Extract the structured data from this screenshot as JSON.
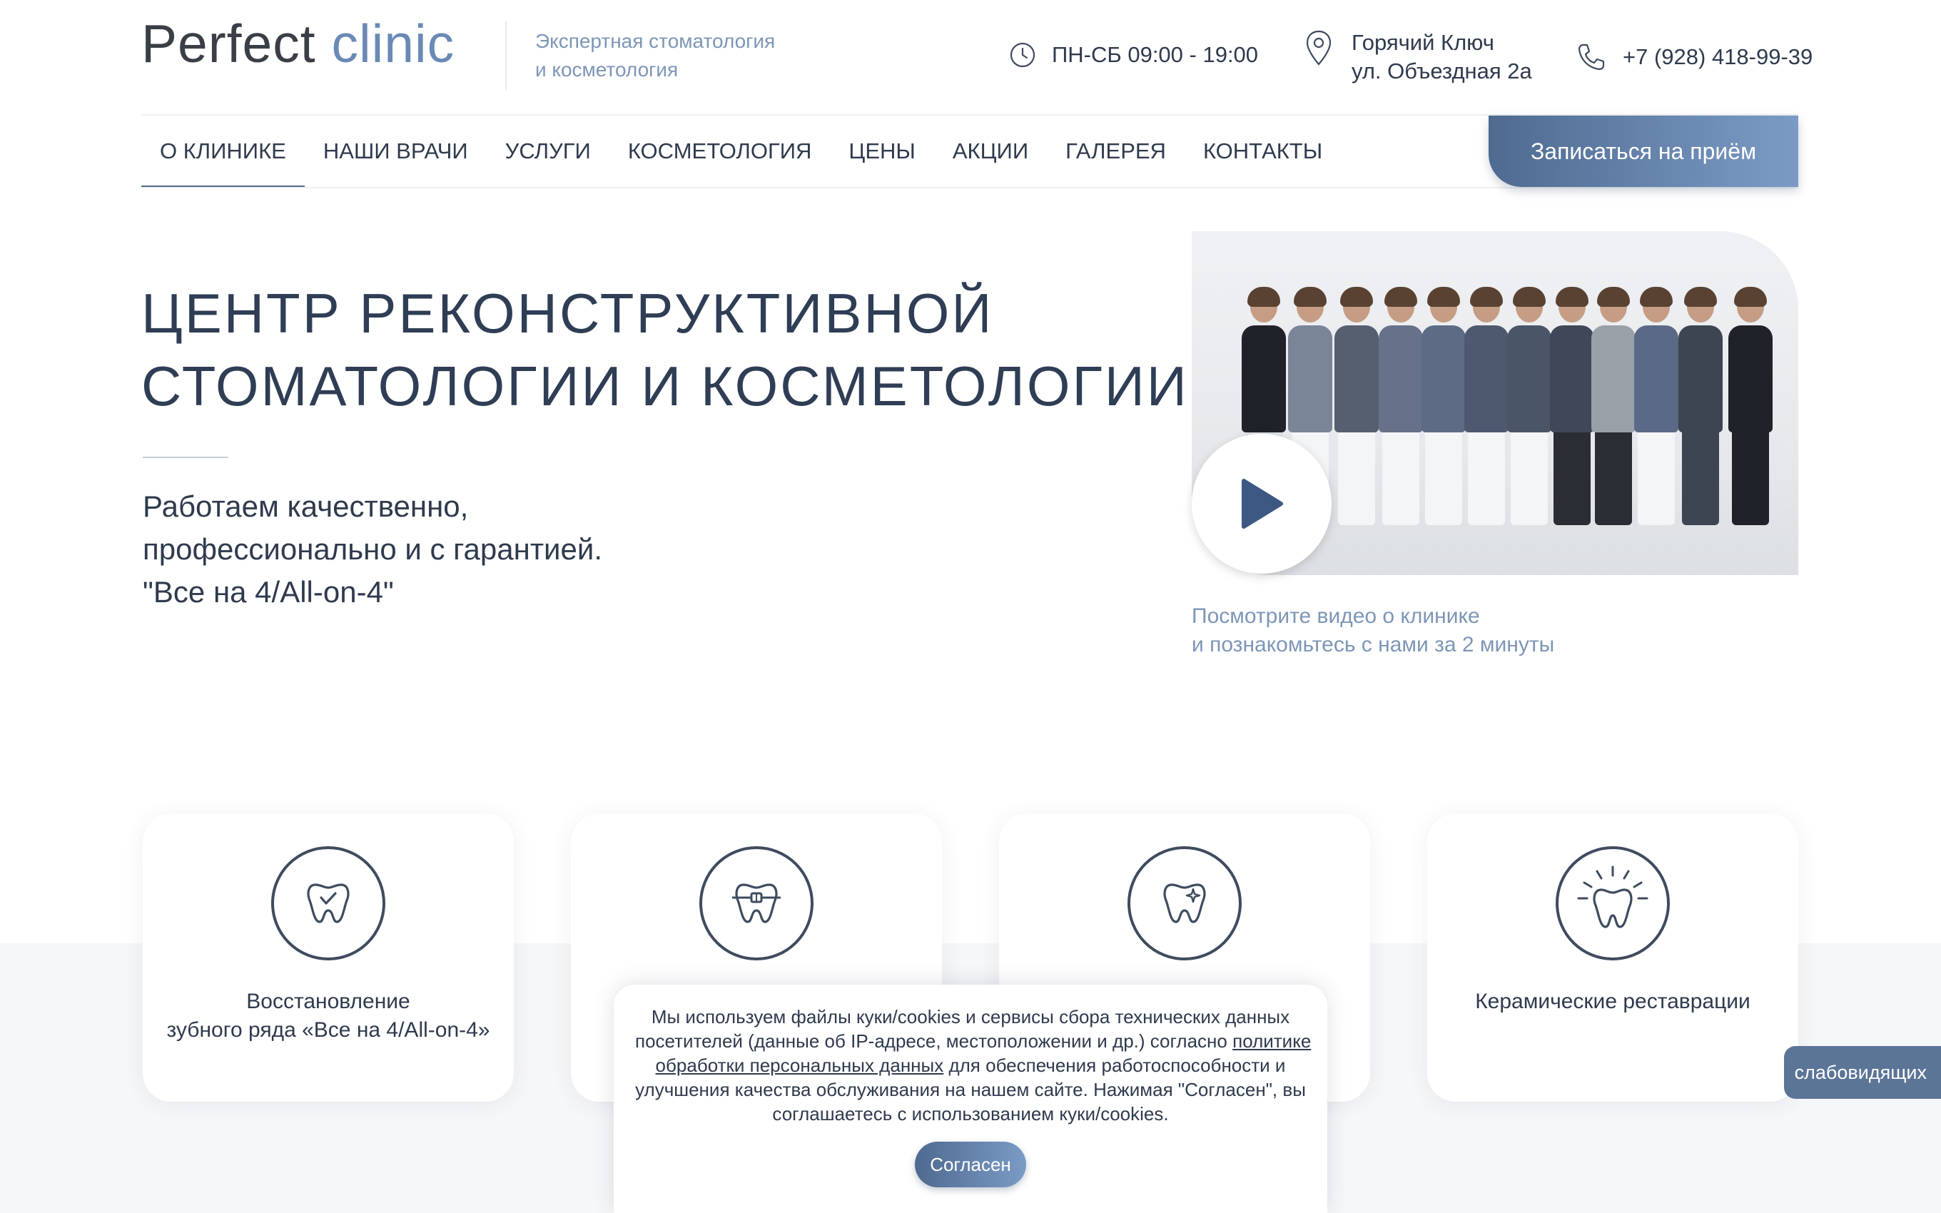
{
  "header": {
    "logo": {
      "word1": "Perfect",
      "word2": "clinic"
    },
    "tagline": [
      "Экспертная стоматология",
      "и косметология"
    ],
    "hours": "ПН-СБ 09:00 - 19:00",
    "address": [
      "Горячий Ключ",
      "ул. Объездная 2а"
    ],
    "phone": "+7 (928) 418-99-39"
  },
  "nav": {
    "items": [
      {
        "label": "О клинике",
        "active": true
      },
      {
        "label": "Наши врачи"
      },
      {
        "label": "Услуги"
      },
      {
        "label": "Косметология"
      },
      {
        "label": "Цены"
      },
      {
        "label": "Акции"
      },
      {
        "label": "Галерея"
      },
      {
        "label": "Контакты"
      }
    ],
    "cta_label": "Записаться на приём"
  },
  "hero": {
    "title": [
      "Центр реконструктивной",
      "стоматологии и косметологии"
    ],
    "subtitle": [
      "Работаем качественно,",
      "профессионально и с гарантией.",
      "\"Все на 4/All-on-4\""
    ]
  },
  "video": {
    "caption": [
      "Посмотрите видео о клинике",
      "и познакомьтесь с нами за 2 минуты"
    ]
  },
  "services": [
    {
      "icon": "tooth-check-icon",
      "label": [
        "Восстановление",
        "зубного ряда «Все на 4/All-on-4»"
      ]
    },
    {
      "icon": "tooth-braces-icon",
      "label": []
    },
    {
      "icon": "tooth-sparkle-icon",
      "label": []
    },
    {
      "icon": "tooth-shine-icon",
      "label": [
        "Керамические реставрации"
      ]
    }
  ],
  "cookie": {
    "line1": "Мы используем файлы куки/cookies и сервисы сбора технических данных",
    "line2a": "посетителей (данные об IP-адресе, местоположении и др.) согласно ",
    "link1": "политике",
    "link2": "обработки персональных данных",
    "line3b": " для обеспечения работоспособности и",
    "line4": "улучшения качества обслуживания на нашем сайте. Нажимая \"Согласен\", вы",
    "line5": "соглашаетесь с использованием куки/cookies.",
    "button": "Согласен"
  },
  "accessibility_label": "слабовидящих",
  "colors": {
    "accent": "#6a8ab5",
    "text": "#2f3a4d",
    "button_start": "#4e6a8f",
    "button_end": "#7b9bc6"
  }
}
